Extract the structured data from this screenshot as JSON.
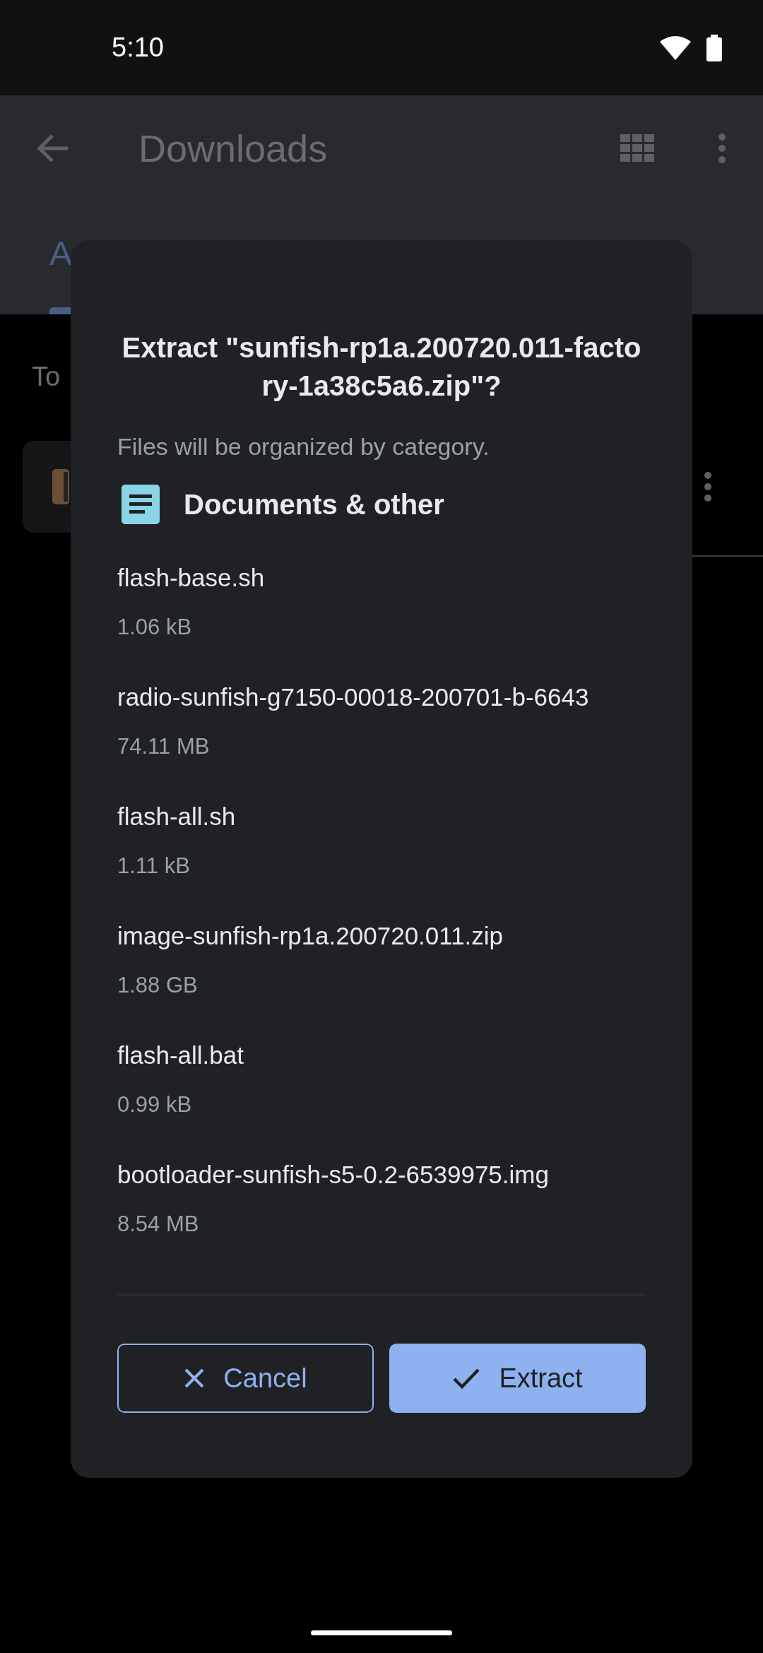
{
  "status_bar": {
    "time": "5:10"
  },
  "app_bar": {
    "title": "Downloads"
  },
  "tabs": [
    {
      "label": "A",
      "selected": true
    }
  ],
  "section": {
    "title": "To"
  },
  "dialog": {
    "title": "Extract \"sunfish-rp1a.200720.011-factory-1a38c5a6.zip\"?",
    "subtitle": "Files will be organized by category.",
    "category": {
      "label": "Documents & other"
    },
    "files": [
      {
        "name": "flash-base.sh",
        "size": "1.06 kB"
      },
      {
        "name": "radio-sunfish-g7150-00018-200701-b-6643",
        "size": "74.11 MB"
      },
      {
        "name": "flash-all.sh",
        "size": "1.11 kB"
      },
      {
        "name": "image-sunfish-rp1a.200720.011.zip",
        "size": "1.88 GB"
      },
      {
        "name": "flash-all.bat",
        "size": "0.99 kB"
      },
      {
        "name": "bootloader-sunfish-s5-0.2-6539975.img",
        "size": "8.54 MB"
      }
    ],
    "buttons": [
      {
        "label": "Cancel",
        "kind": "outlined"
      },
      {
        "label": "Extract",
        "kind": "filled"
      }
    ]
  }
}
